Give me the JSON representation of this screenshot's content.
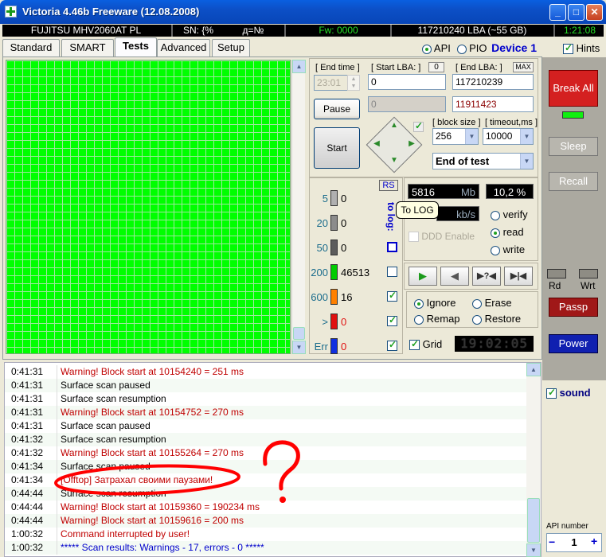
{
  "window": {
    "title": "Victoria 4.46b Freeware (12.08.2008)",
    "btn_minimize": "_",
    "btn_maximize": "□",
    "btn_close": "✕"
  },
  "infobar": {
    "drive": "FUJITSU MHV2060AT PL",
    "serial": "SN: {%",
    "serial_extra": "д=№",
    "firmware": "Fw: 0000",
    "lba": "117210240 LBA (~55 GB)",
    "clock": "1:21:08"
  },
  "tabs": [
    "Standard",
    "SMART",
    "Tests",
    "Advanced",
    "Setup"
  ],
  "mode": {
    "api_label": "API",
    "pio_label": "PIO",
    "device_label": "Device 1",
    "hints_label": "Hints"
  },
  "controls": {
    "end_time_label": "[ End time ]",
    "end_time_value": "23:01",
    "start_lba_label": "[ Start LBA: ]",
    "start_lba_zero": "0",
    "start_lba_value": "0",
    "start_lba_current": "0",
    "end_lba_label": "[ End LBA: ]",
    "end_lba_max": "MAX",
    "end_lba_value": "117210239",
    "end_lba_current": "11911423",
    "pause_label": "Pause",
    "start_label": "Start",
    "block_size_label": "[ block size ]",
    "block_size_value": "256",
    "timeout_label": "[ timeout,ms ]",
    "timeout_value": "10000",
    "end_action_value": "End of test"
  },
  "stats": {
    "rs_label": "RS",
    "to_log_label": "to log:",
    "rows": [
      {
        "label": "5",
        "count": "0",
        "color": "#B0B0B0"
      },
      {
        "label": "20",
        "count": "0",
        "color": "#8C8C8C"
      },
      {
        "label": "50",
        "count": "0",
        "color": "#5C5C5C"
      },
      {
        "label": "200",
        "count": "46513",
        "color": "#00CC00"
      },
      {
        "label": "600",
        "count": "16",
        "color": "#FF8000"
      },
      {
        "label": ">",
        "count": "0",
        "color": "#E01010"
      },
      {
        "label": "Err",
        "count": "0",
        "color": "#1030E0"
      }
    ]
  },
  "speed": {
    "mb_value": "5816",
    "mb_unit": "Mb",
    "percent": "10,2 %",
    "kbs_unit": "kb/s",
    "tooltip": "To LOG",
    "ddd_label": "DDD Enable",
    "verify_label": "verify",
    "read_label": "read",
    "write_label": "write"
  },
  "repair": {
    "ignore_label": "Ignore",
    "erase_label": "Erase",
    "remap_label": "Remap",
    "restore_label": "Restore",
    "grid_label": "Grid",
    "timer": "19:02:05"
  },
  "side": {
    "break_all": "Break All",
    "sleep": "Sleep",
    "recall": "Recall",
    "rd": "Rd",
    "wrt": "Wrt",
    "passp": "Passp",
    "power": "Power",
    "sound": "sound",
    "api_number_label": "API number",
    "api_number_value": "1",
    "minus": "−",
    "plus": "+"
  },
  "log": [
    {
      "time": "0:41:31",
      "msg": "Warning! Block start at 10154240 = 251 ms",
      "color": "#C00000"
    },
    {
      "time": "0:41:31",
      "msg": "Surface scan paused",
      "color": "#000000"
    },
    {
      "time": "0:41:31",
      "msg": "Surface scan resumption",
      "color": "#000000"
    },
    {
      "time": "0:41:31",
      "msg": "Warning! Block start at 10154752 = 270 ms",
      "color": "#C00000"
    },
    {
      "time": "0:41:31",
      "msg": "Surface scan paused",
      "color": "#000000"
    },
    {
      "time": "0:41:32",
      "msg": "Surface scan resumption",
      "color": "#000000"
    },
    {
      "time": "0:41:32",
      "msg": "Warning! Block start at 10155264 = 270 ms",
      "color": "#C00000"
    },
    {
      "time": "0:41:34",
      "msg": "Surface scan paused",
      "color": "#000000"
    },
    {
      "time": "0:41:34",
      "msg": "[Offtop] Затрахал своими паузами!",
      "color": "#C00000"
    },
    {
      "time": "0:44:44",
      "msg": "Surface scan resumption",
      "color": "#000000"
    },
    {
      "time": "0:44:44",
      "msg": "Warning! Block start at 10159360 = 190234 ms",
      "color": "#C00000"
    },
    {
      "time": "0:44:44",
      "msg": "Warning! Block start at 10159616 = 200 ms",
      "color": "#C00000"
    },
    {
      "time": "1:00:32",
      "msg": "Command interrupted by user!",
      "color": "#C00000"
    },
    {
      "time": "1:00:32",
      "msg": "***** Scan results: Warnings - 17, errors - 0 *****",
      "color": "#0000CC"
    }
  ]
}
